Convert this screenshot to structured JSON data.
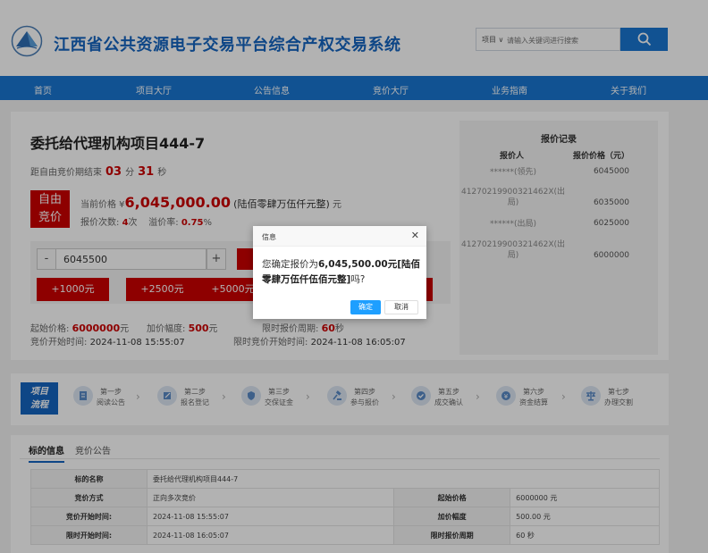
{
  "header": {
    "site_title": "江西省公共资源电子交易平台综合产权交易系统",
    "search_type": "项目",
    "search_placeholder": "请输入关键词进行搜索"
  },
  "nav": {
    "items": [
      "首页",
      "项目大厅",
      "公告信息",
      "竞价大厅",
      "业务指南",
      "关于我们"
    ]
  },
  "project": {
    "title": "委托给代理机构项目444-7",
    "countdown_label": "距自由竞价期结束",
    "countdown_min": "03",
    "min_unit": "分",
    "countdown_sec": "31",
    "sec_unit": "秒",
    "badge_line1": "自由",
    "badge_line2": "竞价",
    "current_price_label": "当前价格 ¥",
    "current_price": "6,045,000.00",
    "current_price_cn": "(陆佰零肆万伍仟元整)",
    "price_unit": "元",
    "bid_count_label": "报价次数:",
    "bid_count": "4",
    "bid_count_unit": "次",
    "premium_label": "溢价率:",
    "premium_rate": "0.75",
    "premium_unit": "%"
  },
  "bid": {
    "minus": "-",
    "value": "6045500",
    "plus": "+",
    "increments": [
      "+1000元",
      "+2500元",
      "+5000元"
    ]
  },
  "meta": {
    "start_price_label": "起始价格:",
    "start_price": "6000000",
    "start_price_unit": "元",
    "step_label": "加价幅度:",
    "step_value": "500",
    "step_unit": "元",
    "period_label": "限时报价周期:",
    "period_value": "60",
    "period_unit": "秒",
    "start_time_label": "竞价开始时间:",
    "start_time": "2024-11-08 15:55:07",
    "limit_time_label": "限时竞价开始时间:",
    "limit_time": "2024-11-08 16:05:07"
  },
  "records": {
    "title": "报价记录",
    "col_bidder": "报价人",
    "col_price": "报价价格（元）",
    "rows": [
      {
        "bidder": "******(领先)",
        "price": "6045000"
      },
      {
        "bidder": "41270219900321462X(出局)",
        "price": "6035000"
      },
      {
        "bidder": "******(出局)",
        "price": "6025000"
      },
      {
        "bidder": "41270219900321462X(出局)",
        "price": "6000000"
      }
    ]
  },
  "steps": {
    "badge_line1": "项目",
    "badge_line2": "流程",
    "items": [
      {
        "num": "第一步",
        "name": "阅读公告"
      },
      {
        "num": "第二步",
        "name": "报名登记"
      },
      {
        "num": "第三步",
        "name": "交保证金"
      },
      {
        "num": "第四步",
        "name": "参与报价"
      },
      {
        "num": "第五步",
        "name": "成交确认"
      },
      {
        "num": "第六步",
        "name": "资金结算"
      },
      {
        "num": "第七步",
        "name": "办理交割"
      }
    ]
  },
  "info": {
    "tabs": [
      "标的信息",
      "竞价公告"
    ],
    "rows": [
      {
        "l1": "标的名称",
        "v1": "委托给代理机构项目444-7"
      },
      {
        "l1": "竞价方式",
        "v1": "正向多次竞价",
        "l2": "起始价格",
        "v2": "6000000 元"
      },
      {
        "l1": "竞价开始时间:",
        "v1": "2024-11-08 15:55:07",
        "l2": "加价幅度",
        "v2": "500.00 元"
      },
      {
        "l1": "限时开始时间:",
        "v1": "2024-11-08 16:05:07",
        "l2": "限时报价周期",
        "v2": "60 秒"
      }
    ]
  },
  "dialog": {
    "title": "信息",
    "close": "✕",
    "msg_prefix": "您确定报价为",
    "msg_amount": "6,045,500.00元[陆佰零肆万伍仟伍佰元整]",
    "msg_suffix": "吗?",
    "ok": "确定",
    "cancel": "取消"
  },
  "colors": {
    "primary": "#1976d2",
    "accent_red": "#cc0000",
    "dialog_ok": "#1e9fff"
  }
}
